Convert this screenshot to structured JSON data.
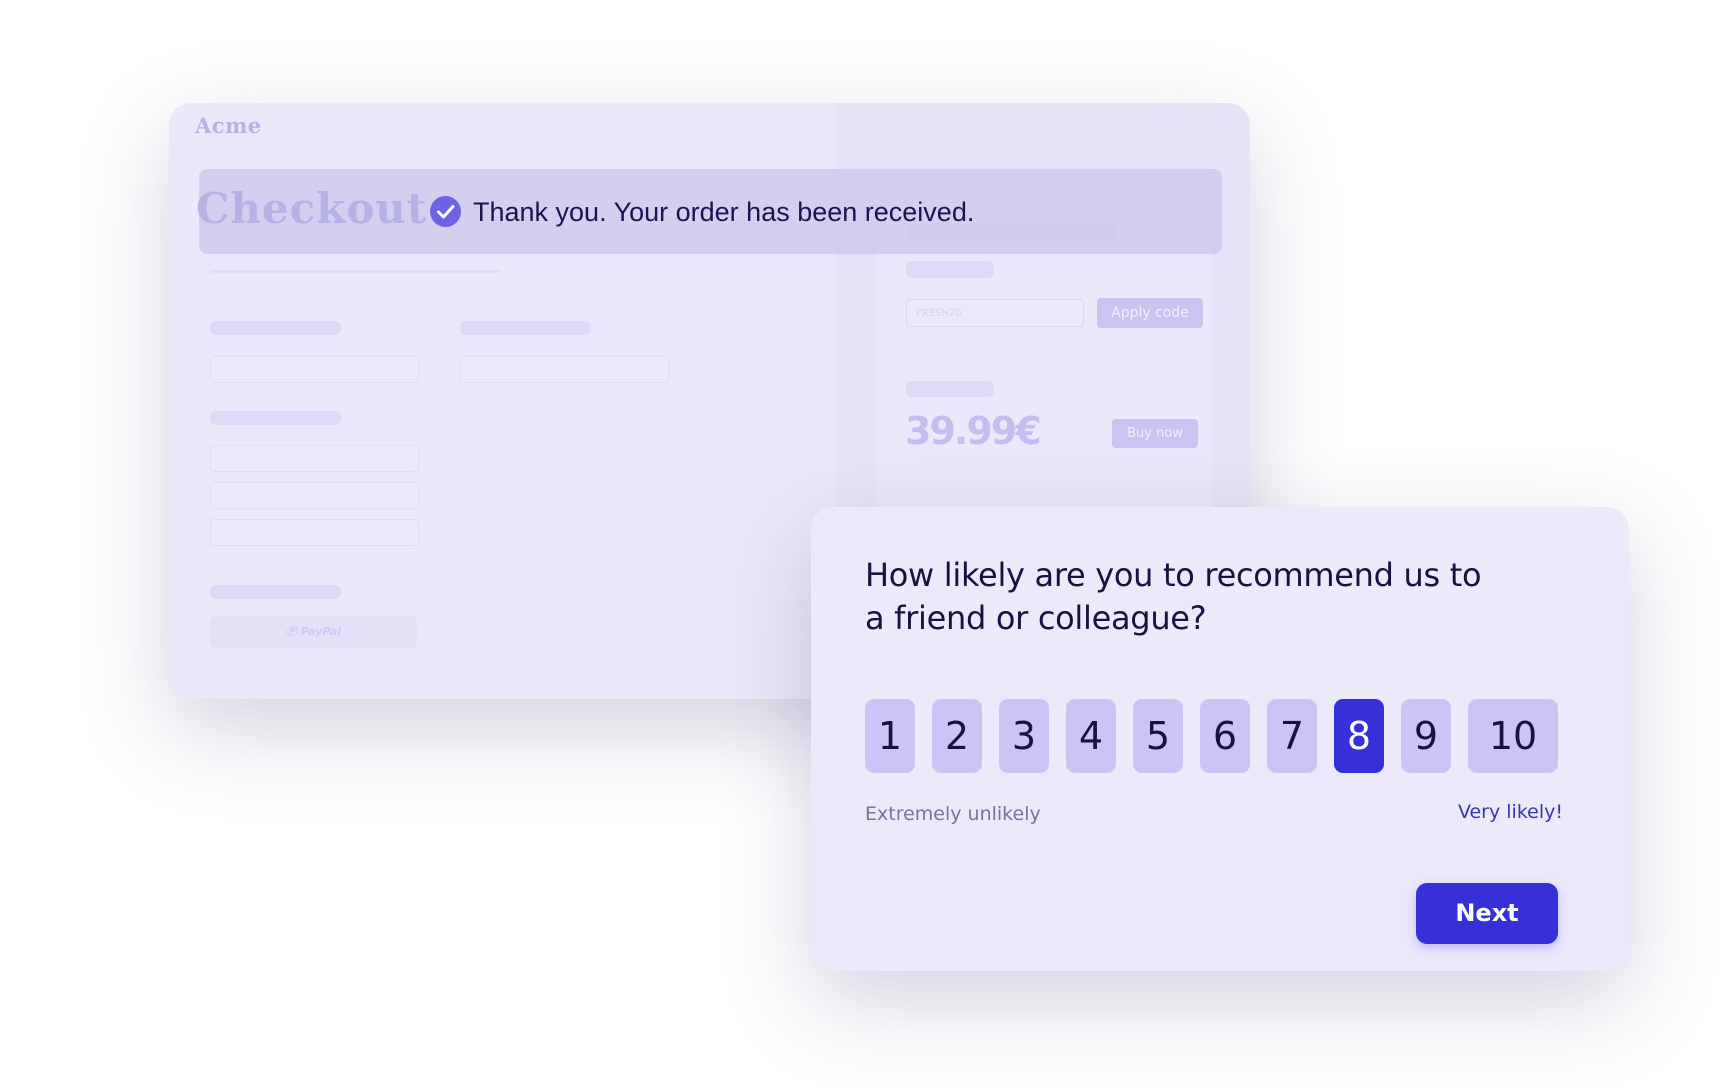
{
  "colors": {
    "accent": "#3530d8",
    "score_default": "#cac5f4",
    "card_background": "#ece9fb",
    "success_check": "#6d63e4"
  },
  "checkout": {
    "brand": "Acme",
    "title": "Checkout",
    "success_icon": "check-circle-icon",
    "success_message": "Thank you. Your order has been received.",
    "discount_placeholder": "FRESH20",
    "apply_label": "Apply code",
    "price": "39.99€",
    "buy_label": "Buy now",
    "paypal_label": "PayPal"
  },
  "survey": {
    "question": "How likely are you to recommend us to a friend or colleague?",
    "scores": [
      "1",
      "2",
      "3",
      "4",
      "5",
      "6",
      "7",
      "8",
      "9",
      "10"
    ],
    "selected_score": "8",
    "low_label": "Extremely unlikely",
    "high_label": "Very likely!",
    "next_label": "Next"
  }
}
